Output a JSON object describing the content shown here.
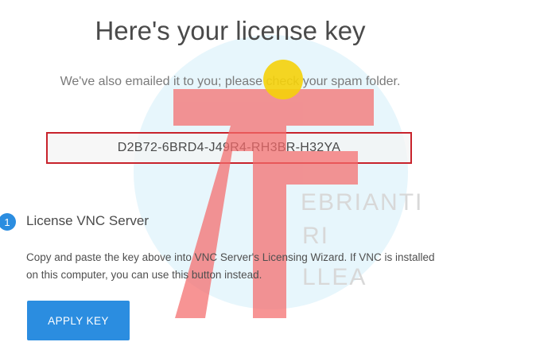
{
  "header": {
    "title": "Here's your license key",
    "subtitle": "We've also emailed it to you; please check your spam folder."
  },
  "license": {
    "key": "D2B72-6BRD4-J49R4-RH3BR-H32YA"
  },
  "step": {
    "number": "1",
    "title": "License VNC Server",
    "description": "Copy and paste the key above into VNC Server's Licensing Wizard. If VNC is installed on this computer, you can use this button instead.",
    "button_label": "APPLY KEY"
  },
  "watermark": {
    "line1": "EBRIANTI",
    "line2": "RI",
    "line3": "LLEA"
  },
  "colors": {
    "accent": "#2b8de0",
    "highlight_border": "#c8232c",
    "watermark_red": "#f56b6b",
    "cursor": "#f5d10a"
  }
}
